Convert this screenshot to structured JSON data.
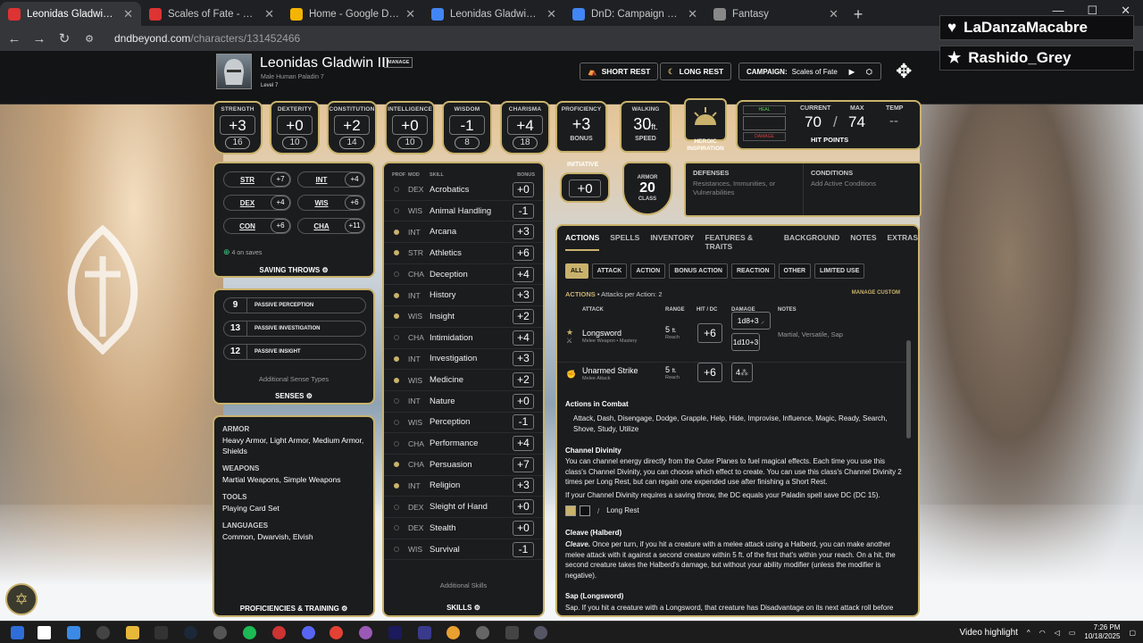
{
  "browser": {
    "tabs": [
      {
        "title": "Leonidas Gladwin III's Characte",
        "active": true,
        "icon": "dndbeyond-icon",
        "color": "#d33"
      },
      {
        "title": "Scales of Fate - D&D Beyond",
        "active": false,
        "icon": "dndbeyond-icon",
        "color": "#d33"
      },
      {
        "title": "Home - Google Drive",
        "active": false,
        "icon": "drive-icon",
        "color": "#f4b400"
      },
      {
        "title": "Leonidas Gladwin III - Google D",
        "active": false,
        "icon": "docs-icon",
        "color": "#4285f4"
      },
      {
        "title": "DnD: Campaign 4 Notes - Goog",
        "active": false,
        "icon": "docs-icon",
        "color": "#4285f4"
      },
      {
        "title": "Fantasy",
        "active": false,
        "icon": "page-icon",
        "color": "#888"
      }
    ],
    "url_host": "dndbeyond.com",
    "url_path": "/characters/131452466"
  },
  "overlay": {
    "follower": "LaDanzaMacabre",
    "subscriber": "Rashido_Grey"
  },
  "character": {
    "name": "Leonidas Gladwin III",
    "manage_label": "MANAGE",
    "subtitle": "Male  Human  Paladin 7",
    "level": "Level 7",
    "short_rest": "SHORT REST",
    "long_rest": "LONG REST",
    "campaign_label": "CAMPAIGN:",
    "campaign_name": "Scales of Fate"
  },
  "abilities": [
    {
      "label": "STRENGTH",
      "mod": "+3",
      "score": "16"
    },
    {
      "label": "DEXTERITY",
      "mod": "+0",
      "score": "10"
    },
    {
      "label": "CONSTITUTION",
      "mod": "+2",
      "score": "14"
    },
    {
      "label": "INTELLIGENCE",
      "mod": "+0",
      "score": "10"
    },
    {
      "label": "WISDOM",
      "mod": "-1",
      "score": "8"
    },
    {
      "label": "CHARISMA",
      "mod": "+4",
      "score": "18"
    }
  ],
  "proficiency": {
    "label": "PROFICIENCY",
    "value": "+3",
    "sub": "BONUS"
  },
  "speed": {
    "label": "WALKING",
    "value": "30",
    "unit": "ft.",
    "sub": "SPEED"
  },
  "heroic": "HEROIC INSPIRATION",
  "hp": {
    "heal": "HEAL",
    "damage": "DAMAGE",
    "current_label": "CURRENT",
    "max_label": "MAX",
    "temp_label": "TEMP",
    "current": "70",
    "max": "74",
    "temp": "--",
    "slash": "/",
    "title": "HIT POINTS"
  },
  "initiative": {
    "label": "INITIATIVE",
    "value": "+0"
  },
  "armor": {
    "label_top": "ARMOR",
    "value": "20",
    "label_bottom": "CLASS"
  },
  "defenses": {
    "title": "DEFENSES",
    "text": "Resistances, Immunities, or Vulnerabilities"
  },
  "conditions": {
    "title": "CONDITIONS",
    "text": "Add Active Conditions"
  },
  "saving_throws": {
    "items": [
      {
        "k": "STR",
        "v": "+7"
      },
      {
        "k": "INT",
        "v": "+4"
      },
      {
        "k": "DEX",
        "v": "+4"
      },
      {
        "k": "WIS",
        "v": "+6"
      },
      {
        "k": "CON",
        "v": "+6"
      },
      {
        "k": "CHA",
        "v": "+11"
      }
    ],
    "note": "4 on saves",
    "title": "SAVING THROWS"
  },
  "senses": {
    "items": [
      {
        "n": "9",
        "t": "PASSIVE PERCEPTION"
      },
      {
        "n": "13",
        "t": "PASSIVE INVESTIGATION"
      },
      {
        "n": "12",
        "t": "PASSIVE INSIGHT"
      }
    ],
    "additional": "Additional Sense Types",
    "title": "SENSES"
  },
  "proficiencies": {
    "armor_h": "ARMOR",
    "armor": "Heavy Armor, Light Armor, Medium Armor, Shields",
    "weapons_h": "WEAPONS",
    "weapons": "Martial Weapons, Simple Weapons",
    "tools_h": "TOOLS",
    "tools": "Playing Card Set",
    "languages_h": "LANGUAGES",
    "languages": "Common, Dwarvish, Elvish",
    "title": "PROFICIENCIES & TRAINING"
  },
  "skills": {
    "head_prof": "PROF",
    "head_mod": "MOD",
    "head_skill": "SKILL",
    "head_bonus": "BONUS",
    "items": [
      {
        "p": false,
        "ab": "DEX",
        "name": "Acrobatics",
        "b": "+0"
      },
      {
        "p": false,
        "ab": "WIS",
        "name": "Animal Handling",
        "b": "-1"
      },
      {
        "p": true,
        "ab": "INT",
        "name": "Arcana",
        "b": "+3"
      },
      {
        "p": true,
        "ab": "STR",
        "name": "Athletics",
        "b": "+6"
      },
      {
        "p": false,
        "ab": "CHA",
        "name": "Deception",
        "b": "+4"
      },
      {
        "p": true,
        "ab": "INT",
        "name": "History",
        "b": "+3"
      },
      {
        "p": true,
        "ab": "WIS",
        "name": "Insight",
        "b": "+2"
      },
      {
        "p": false,
        "ab": "CHA",
        "name": "Intimidation",
        "b": "+4"
      },
      {
        "p": true,
        "ab": "INT",
        "name": "Investigation",
        "b": "+3"
      },
      {
        "p": true,
        "ab": "WIS",
        "name": "Medicine",
        "b": "+2"
      },
      {
        "p": false,
        "ab": "INT",
        "name": "Nature",
        "b": "+0"
      },
      {
        "p": false,
        "ab": "WIS",
        "name": "Perception",
        "b": "-1"
      },
      {
        "p": false,
        "ab": "CHA",
        "name": "Performance",
        "b": "+4"
      },
      {
        "p": true,
        "ab": "CHA",
        "name": "Persuasion",
        "b": "+7"
      },
      {
        "p": true,
        "ab": "INT",
        "name": "Religion",
        "b": "+3"
      },
      {
        "p": false,
        "ab": "DEX",
        "name": "Sleight of Hand",
        "b": "+0"
      },
      {
        "p": false,
        "ab": "DEX",
        "name": "Stealth",
        "b": "+0"
      },
      {
        "p": false,
        "ab": "WIS",
        "name": "Survival",
        "b": "-1"
      }
    ],
    "additional": "Additional Skills",
    "title": "SKILLS"
  },
  "actions": {
    "tabs": [
      "ACTIONS",
      "SPELLS",
      "INVENTORY",
      "FEATURES & TRAITS",
      "BACKGROUND",
      "NOTES",
      "EXTRAS"
    ],
    "filters": [
      "ALL",
      "ATTACK",
      "ACTION",
      "BONUS ACTION",
      "REACTION",
      "OTHER",
      "LIMITED USE"
    ],
    "heading": "ACTIONS",
    "per_action": "• Attacks per Action: 2",
    "manage_custom": "MANAGE CUSTOM",
    "col_attack": "ATTACK",
    "col_range": "RANGE",
    "col_hit": "HIT / DC",
    "col_damage": "DAMAGE",
    "col_notes": "NOTES",
    "longsword": {
      "name": "Longsword",
      "sub": "Melee Weapon • Mastery",
      "range": "5",
      "range_unit": "ft.",
      "range_sub": "Reach",
      "hit": "+6",
      "dmg1": "1d8+3",
      "dmg2": "1d10+3",
      "notes": "Martial, Versatile, Sap"
    },
    "unarmed": {
      "name": "Unarmed Strike",
      "sub": "Melee Attack",
      "range": "5",
      "range_unit": "ft.",
      "range_sub": "Reach",
      "hit": "+6",
      "dmg": "4"
    },
    "combat_h": "Actions in Combat",
    "combat_list": "Attack, Dash, Disengage, Dodge, Grapple, Help, Hide, Improvise, Influence, Magic, Ready, Search, Shove, Study, Utilize",
    "cd_h": "Channel Divinity",
    "cd_p1": "You can channel energy directly from the Outer Planes to fuel magical effects. Each time you use this class's Channel Divinity, you can choose which effect to create. You can use this class's Channel Divinity 2 times per Long Rest, but can regain one expended use after finishing a Short Rest.",
    "cd_p2": "If your Channel Divinity requires a saving throw, the DC equals your Paladin spell save DC (DC 15).",
    "long_rest": "Long Rest",
    "cleave_h": "Cleave (Halberd)",
    "cleave_lead": "Cleave.",
    "cleave": " Once per turn, if you hit a creature with a melee attack using a Halberd, you can make another melee attack with it against a second creature within 5 ft. of the first that's within your reach. On a hit, the second creature takes the Halberd's damage, but without your ability modifier (unless the modifier is negative).",
    "sap_h": "Sap (Longsword)",
    "sap": "Sap. If you hit a creature with a Longsword, that creature has Disadvantage on its next attack roll before"
  },
  "taskbar": {
    "video_highlight": "Video highlight",
    "time": "7:26 PM",
    "date": "10/18/2025"
  }
}
